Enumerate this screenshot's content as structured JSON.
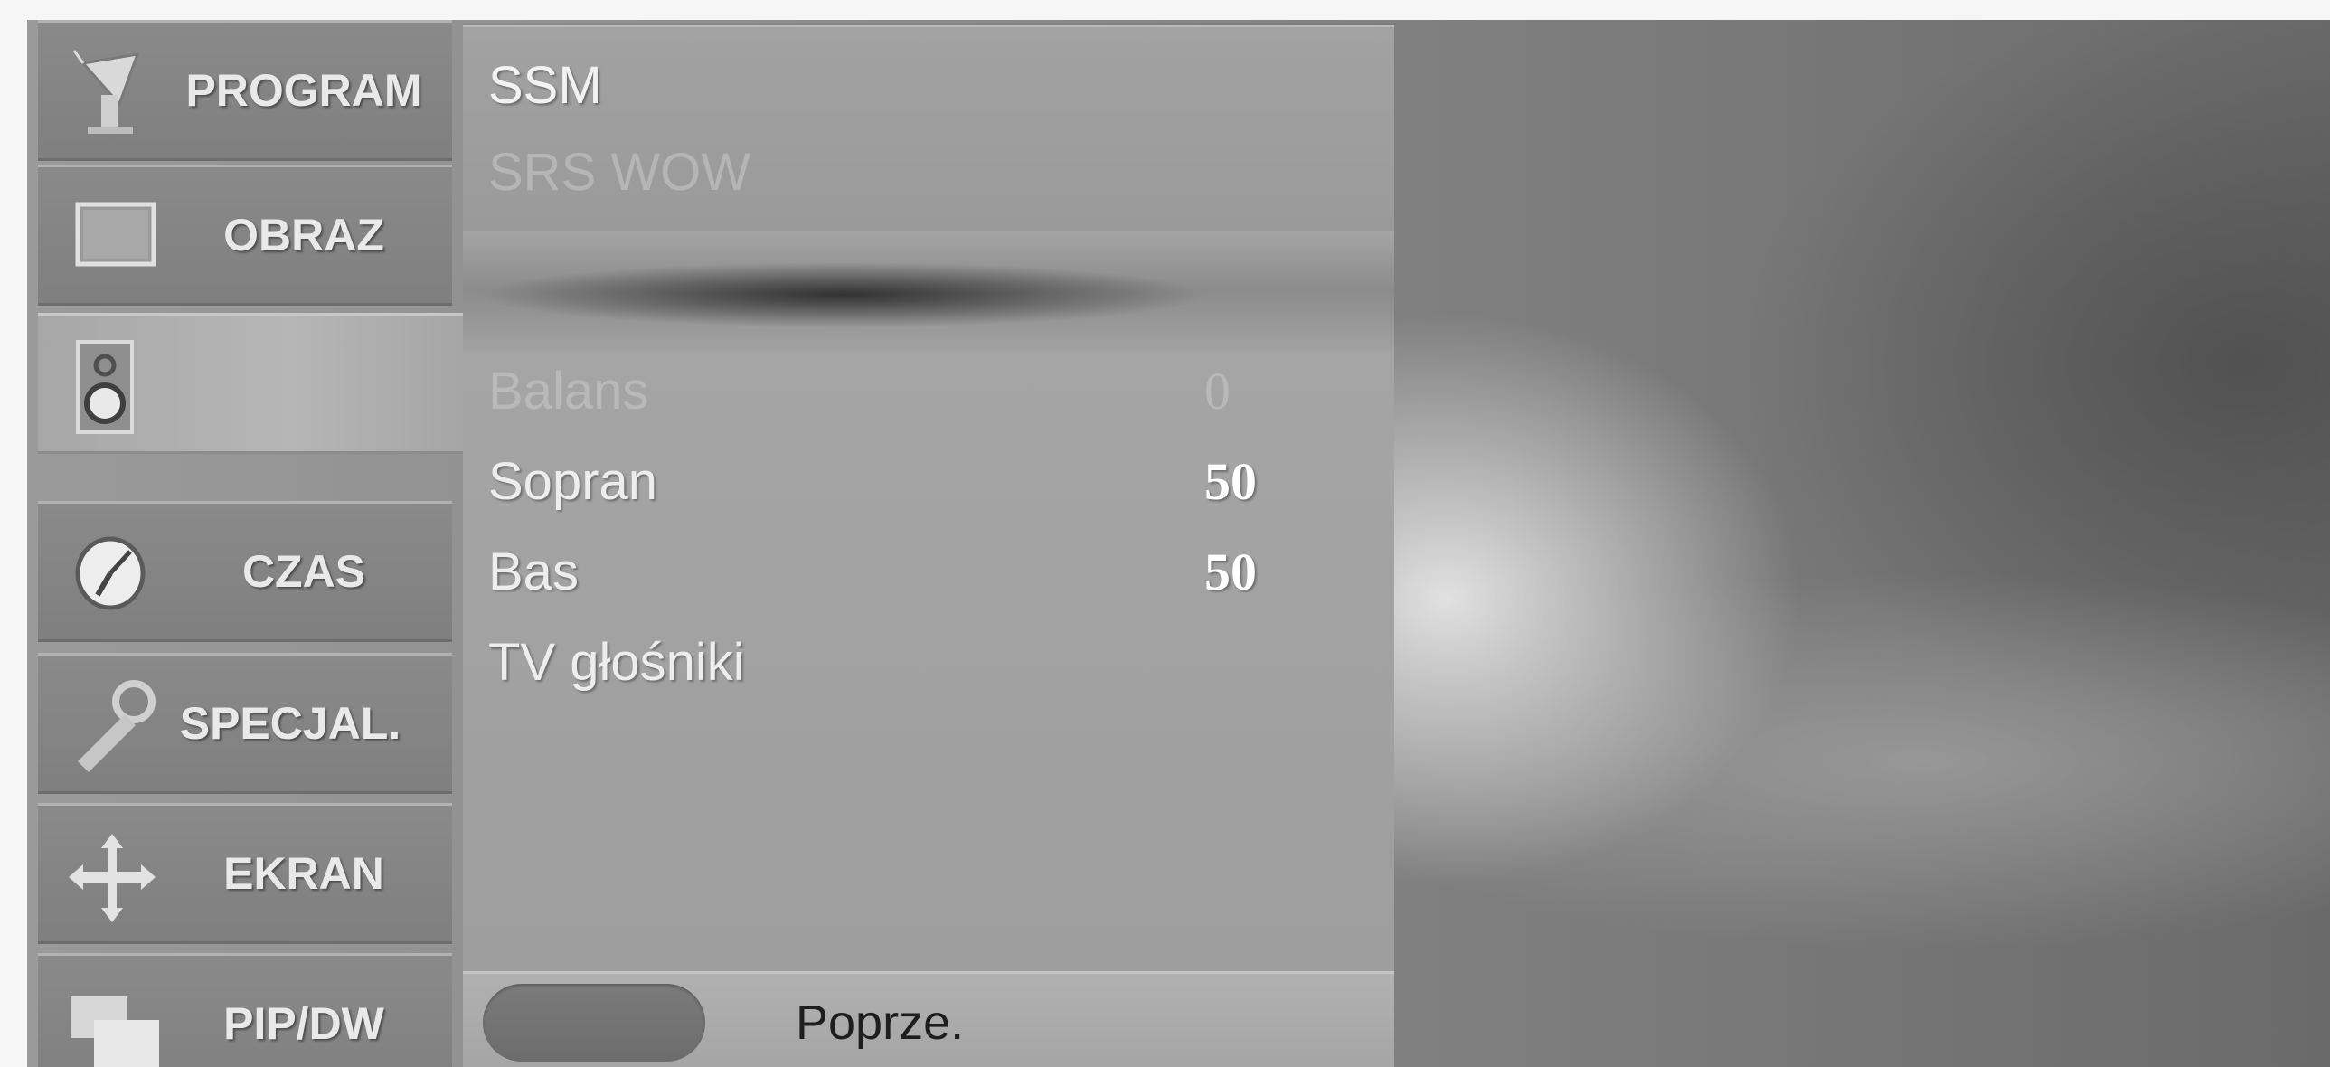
{
  "sidebar": {
    "items": [
      {
        "label": "PROGRAM",
        "icon": "satellite-dish-icon"
      },
      {
        "label": "OBRAZ",
        "icon": "picture-icon"
      },
      {
        "label": "",
        "icon": "speaker-icon",
        "active": true
      },
      {
        "label": "CZAS",
        "icon": "clock-icon"
      },
      {
        "label": "SPECJAL.",
        "icon": "key-icon"
      },
      {
        "label": "EKRAN",
        "icon": "move-arrows-icon"
      },
      {
        "label": "PIP/DW",
        "icon": "pip-windows-icon"
      }
    ]
  },
  "top_menu": {
    "ssm": "SSM",
    "srs_wow": "SRS WOW"
  },
  "settings": [
    {
      "label": "Balans",
      "value": "0",
      "dim": true
    },
    {
      "label": "Sopran",
      "value": "50"
    },
    {
      "label": "Bas",
      "value": "50"
    },
    {
      "label": "TV głośniki",
      "value": ""
    }
  ],
  "footer": {
    "prev_label": "Poprze."
  },
  "colors": {
    "panel": "#a2a2a2",
    "sidebar_item": "#858585",
    "text_bright": "#f2f2f2",
    "text_dim": "#b5b5b5",
    "footer_button": "#737373"
  }
}
